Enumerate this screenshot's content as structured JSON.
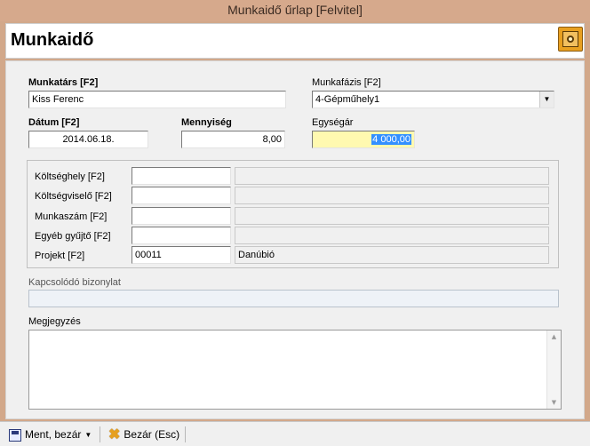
{
  "window": {
    "title": "Munkaidő űrlap [Felvitel]"
  },
  "header": {
    "title": "Munkaidő",
    "icon": "safe-icon"
  },
  "form": {
    "worker": {
      "label": "Munkatárs [F2]",
      "value": "Kiss Ferenc"
    },
    "phase": {
      "label": "Munkafázis [F2]",
      "value": "4-Gépműhely1"
    },
    "date": {
      "label": "Dátum [F2]",
      "value": "2014.06.18."
    },
    "quantity": {
      "label": "Mennyiség",
      "value": "8,00"
    },
    "unit_price": {
      "label": "Egységár",
      "value": "4 000,00"
    },
    "cost_rows": [
      {
        "label": "Költséghely [F2]",
        "code": "",
        "name": ""
      },
      {
        "label": "Költségviselő [F2]",
        "code": "",
        "name": ""
      },
      {
        "label": "Munkaszám [F2]",
        "code": "",
        "name": ""
      },
      {
        "label": "Egyéb gyűjtő [F2]",
        "code": "",
        "name": ""
      },
      {
        "label": "Projekt [F2]",
        "code": "00011",
        "name": "Danúbió"
      }
    ],
    "related_doc": {
      "label": "Kapcsolódó bizonylat",
      "value": ""
    },
    "notes": {
      "label": "Megjegyzés",
      "value": ""
    }
  },
  "toolbar": {
    "save_label": "Ment, bezár",
    "close_label": "Bezár (Esc)"
  }
}
